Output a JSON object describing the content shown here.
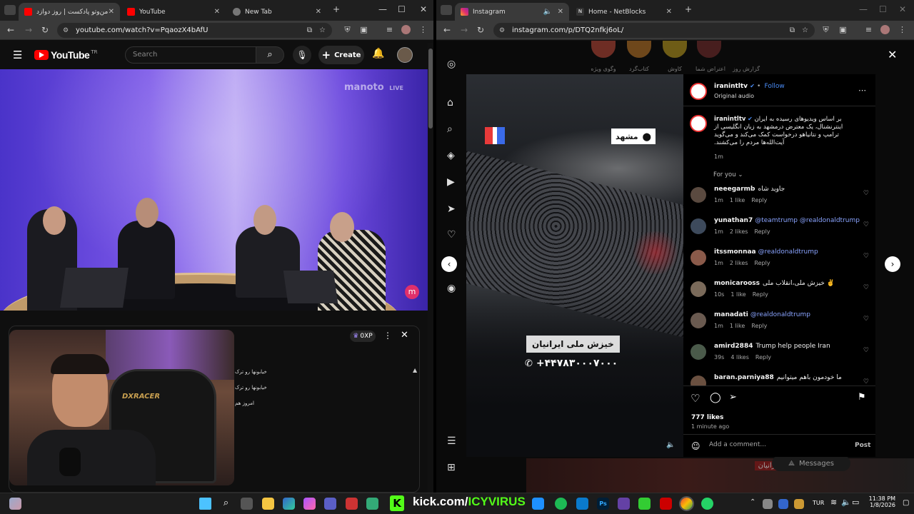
{
  "left_browser": {
    "tabs": [
      {
        "label": "من‌وتو پادکست | روز دوازد",
        "active": true
      },
      {
        "label": "YouTube",
        "active": false
      },
      {
        "label": "New Tab",
        "active": false
      }
    ],
    "url": "youtube.com/watch?v=PqaozX4bAfU"
  },
  "youtube": {
    "logo": "YouTube",
    "region": "TR",
    "search_placeholder": "Search",
    "create_label": "Create",
    "watermark": "manoto",
    "watermark_live": "LIVE",
    "xp_label": "0XP",
    "chat_lines": [
      "خیابونها رو ترک",
      "خیابونها رو ترک",
      "امروز هم"
    ]
  },
  "right_browser": {
    "tabs": [
      {
        "label": "Instagram",
        "active": true
      },
      {
        "label": "Home - NetBlocks",
        "active": false
      }
    ],
    "url": "instagram.com/p/DTQ2nfkj6oL/"
  },
  "instagram": {
    "stories": [
      "وگوی ویژه",
      "کتاب‌گرد",
      "کاوش",
      "اعتراض شما",
      "گزارش روز"
    ],
    "video_location": "مشهد",
    "video_caption": "خیزش ملی ایرانیان",
    "video_phone": "+۴۴۷۸۳۰۰۰۷۰۰۰",
    "post_author": "iranintltv",
    "follow_label": "Follow",
    "audio_label": "Original audio",
    "caption": "بر اساس ویدیوهای رسیده به ایران اینترنشنال، یک معترض درمشهد به زبان انگلیسی از ترامپ و نتانیاهو درخواست کمک می‌کند و می‌گوید آیت‌الله‌ها مردم را می‌کشند.",
    "caption_time": "1m",
    "sort_label": "For you",
    "comments": [
      {
        "user": "neeegarmb",
        "text": "جاوید شاه",
        "mention": "",
        "time": "1m",
        "likes": "1 like",
        "reply": "Reply",
        "color": "#5a4a40"
      },
      {
        "user": "yunathan7",
        "text": "",
        "mention": "@teamtrump @realdonaldtrump",
        "time": "1m",
        "likes": "2 likes",
        "reply": "Reply",
        "color": "#3d4a5c"
      },
      {
        "user": "itssmonnaa",
        "text": "",
        "mention": "@realdonaldtrump",
        "time": "1m",
        "likes": "2 likes",
        "reply": "Reply",
        "color": "#8a5a4a"
      },
      {
        "user": "monicarooss",
        "text": "خیزش ملی،انقلاب ملی ✌️",
        "mention": "",
        "time": "10s",
        "likes": "1 like",
        "reply": "Reply",
        "color": "#7a6a5a"
      },
      {
        "user": "manadati",
        "text": "",
        "mention": "@realdonaldtrump",
        "time": "1m",
        "likes": "1 like",
        "reply": "Reply",
        "color": "#6a5a50"
      },
      {
        "user": "amird2884",
        "text": "Trump help people Iran",
        "mention": "",
        "time": "39s",
        "likes": "4 likes",
        "reply": "Reply",
        "color": "#4a5a4a"
      },
      {
        "user": "baran.parniya88",
        "text": "ما خودمون باهم میتوانیم",
        "mention": "",
        "time": "",
        "likes": "",
        "reply": "",
        "color": "#6a5040"
      }
    ],
    "likes_count": "777 likes",
    "post_time": "1 minute ago",
    "comment_placeholder": "Add a comment...",
    "post_label": "Post",
    "messages_label": "Messages",
    "bg_banner": "خیزش ملی ایرانیان"
  },
  "taskbar": {
    "kick_label": "kick.com/",
    "kick_user": "ICYVIRUS",
    "language": "TUR",
    "time": "11:38 PM",
    "date": "1/8/2026"
  },
  "colors": {
    "yt_red": "#ff0000",
    "ig_blue": "#4a8df8",
    "kick_green": "#53fc18"
  }
}
